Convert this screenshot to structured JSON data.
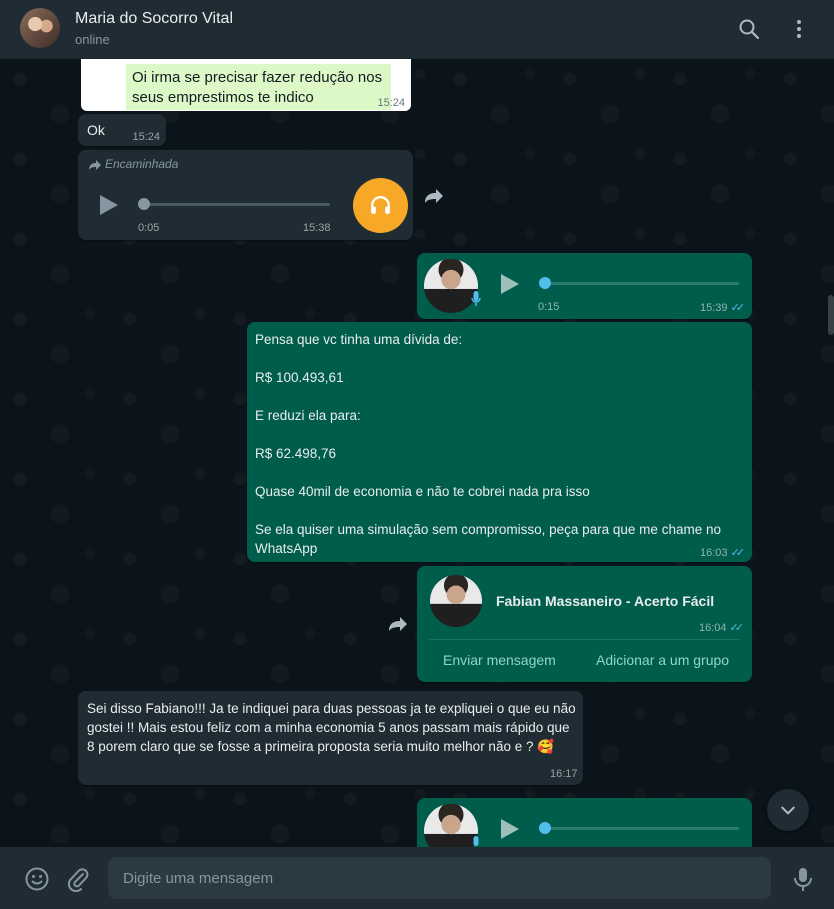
{
  "header": {
    "contact_name": "Maria do Socorro Vital",
    "status": "online"
  },
  "messages": {
    "quoted": {
      "text": "Oi irma se precisar fazer redução nos seus emprestimos te indico",
      "time": "15:24"
    },
    "ok": {
      "text": "Ok",
      "time": "15:24"
    },
    "forwarded_audio": {
      "label": "Encaminhada",
      "duration": "0:05",
      "time": "15:38"
    },
    "voice_out_1": {
      "duration": "0:15",
      "time": "15:39"
    },
    "long_out": {
      "text": "Pensa que vc tinha uma dívida de:\n\nR$ 100.493,61\n\nE reduzi ela para:\n\nR$ 62.498,76\n\nQuase 40mil de economia e não te cobrei nada pra isso\n\nSe ela quiser uma simulação sem compromisso, peça para que me chame no WhatsApp",
      "time": "16:03"
    },
    "contact_card": {
      "name": "Fabian Massaneiro - Acerto Fácil",
      "time": "16:04",
      "action_send": "Enviar mensagem",
      "action_group": "Adicionar a um grupo"
    },
    "long_in": {
      "text": "Sei disso Fabiano!!! Ja te indiquei para duas pessoas ja te expliquei o que eu não gostei !! Mais estou feliz com a minha economia 5 anos passam mais rápido que 8 porem claro que se fosse a primeira proposta seria muito melhor não e ? 🥰",
      "time": "16:17"
    }
  },
  "composer": {
    "placeholder": "Digite uma mensagem"
  },
  "colors": {
    "incoming_bubble": "#202c33",
    "outgoing_bubble": "#005c4b",
    "accent": "#00a884",
    "read_ticks": "#53bdeb",
    "forward_headphones": "#f7a826"
  }
}
